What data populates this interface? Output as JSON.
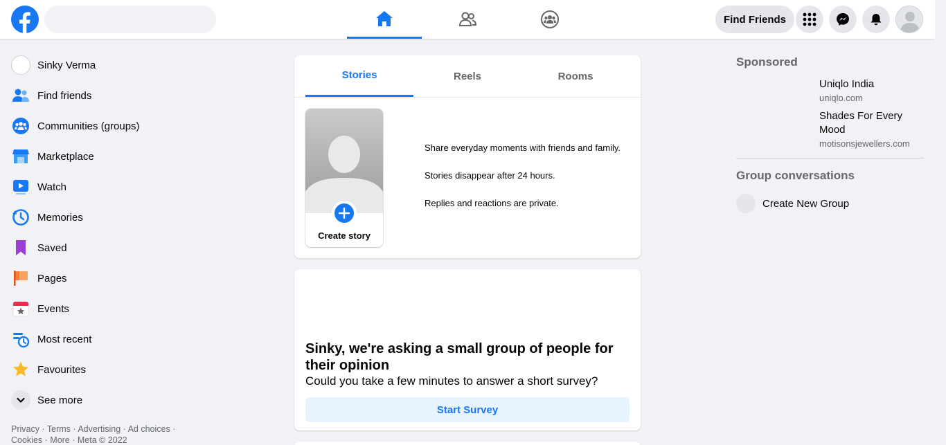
{
  "header": {
    "search_placeholder": "",
    "find_friends_label": "Find Friends"
  },
  "sidebar": {
    "items": [
      {
        "label": "Sinky Verma",
        "icon": "profile-avatar"
      },
      {
        "label": "Find friends",
        "icon": "friends-icon"
      },
      {
        "label": "Communities (groups)",
        "icon": "groups-icon"
      },
      {
        "label": "Marketplace",
        "icon": "marketplace-icon"
      },
      {
        "label": "Watch",
        "icon": "watch-icon"
      },
      {
        "label": "Memories",
        "icon": "memories-icon"
      },
      {
        "label": "Saved",
        "icon": "saved-icon"
      },
      {
        "label": "Pages",
        "icon": "pages-icon"
      },
      {
        "label": "Events",
        "icon": "events-icon"
      },
      {
        "label": "Most recent",
        "icon": "most-recent-icon"
      },
      {
        "label": "Favourites",
        "icon": "favourites-icon"
      },
      {
        "label": "See more",
        "icon": "chevron-down-icon"
      }
    ],
    "footer": {
      "privacy": "Privacy",
      "terms": "Terms",
      "advertising": "Advertising",
      "ad_choices": "Ad choices",
      "cookies": "Cookies",
      "more": "More",
      "meta": "Meta © 2022",
      "sep": " · "
    }
  },
  "stories": {
    "tabs": [
      "Stories",
      "Reels",
      "Rooms"
    ],
    "create_label": "Create story",
    "info": [
      "Share everyday moments with friends and family.",
      "Stories disappear after 24 hours.",
      "Replies and reactions are private."
    ]
  },
  "survey": {
    "title": "Sinky, we're asking a small group of people for their opinion",
    "subtitle": "Could you take a few minutes to answer a short survey?",
    "button": "Start Survey"
  },
  "right": {
    "sponsored_heading": "Sponsored",
    "ads": [
      {
        "title": "Uniqlo India",
        "domain": "uniqlo.com"
      },
      {
        "title": "Shades For Every Mood",
        "domain": "motisonsjewellers.com"
      }
    ],
    "group_heading": "Group conversations",
    "create_group_label": "Create New Group"
  },
  "colors": {
    "brand": "#1877f2",
    "background": "#f0f2f5",
    "secondary_text": "#65676b"
  }
}
